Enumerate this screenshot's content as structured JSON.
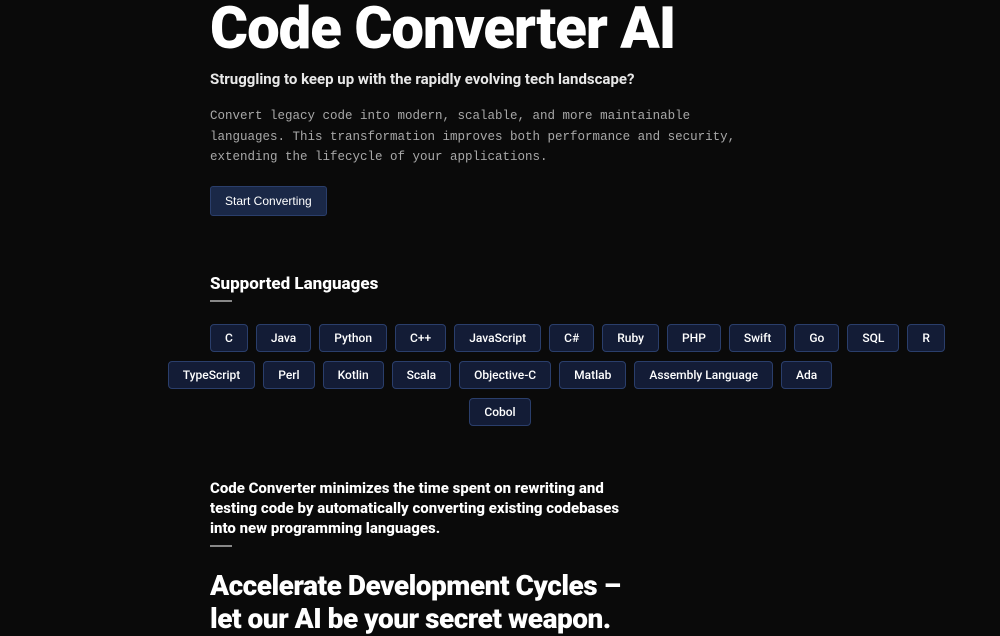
{
  "hero": {
    "title": "Code Converter AI",
    "subtitle": "Struggling to keep up with the rapidly evolving tech landscape?",
    "description": "Convert legacy code into modern, scalable, and more maintainable languages. This transformation improves both performance and security, extending the lifecycle of your applications.",
    "cta_label": "Start Converting"
  },
  "languages": {
    "heading": "Supported Languages",
    "row1": [
      "C",
      "Java",
      "Python",
      "C++",
      "JavaScript",
      "C#",
      "Ruby",
      "PHP",
      "Swift",
      "Go",
      "SQL",
      "R"
    ],
    "row2": [
      "TypeScript",
      "Perl",
      "Kotlin",
      "Scala",
      "Objective-C",
      "Matlab",
      "Assembly Language",
      "Ada"
    ],
    "row3": [
      "Cobol"
    ]
  },
  "benefit": {
    "text": "Code Converter minimizes the time spent on rewriting and testing code by automatically converting existing codebases into new programming languages.",
    "accelerate_line1": "Accelerate Development Cycles –",
    "accelerate_line2": "let our AI be your secret weapon."
  }
}
